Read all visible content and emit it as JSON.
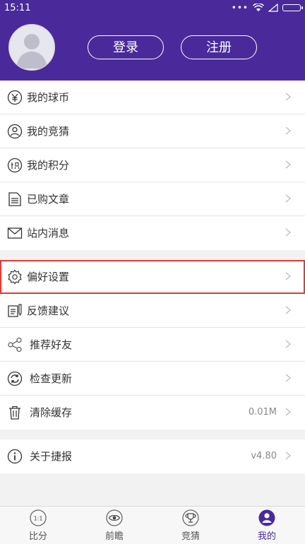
{
  "status_bar": {
    "time": "15:11"
  },
  "header": {
    "login_label": "登录",
    "register_label": "注册"
  },
  "menu_group_1": [
    {
      "label": "我的球币",
      "icon": "yen-coin-icon"
    },
    {
      "label": "我的竞猜",
      "icon": "user-circle-icon"
    },
    {
      "label": "我的积分",
      "icon": "points-icon"
    },
    {
      "label": "已购文章",
      "icon": "document-icon"
    },
    {
      "label": "站内消息",
      "icon": "mail-icon"
    }
  ],
  "menu_group_2": [
    {
      "label": "偏好设置",
      "icon": "gear-icon"
    },
    {
      "label": "反馈建议",
      "icon": "feedback-icon"
    },
    {
      "label": "推荐好友",
      "icon": "share-icon"
    },
    {
      "label": "检查更新",
      "icon": "refresh-icon"
    },
    {
      "label": "清除缓存",
      "icon": "trash-icon",
      "value": "0.01M"
    }
  ],
  "menu_group_3": [
    {
      "label": "关于捷报",
      "icon": "info-icon",
      "value": "v4.80"
    }
  ],
  "tabbar": [
    {
      "label": "比分",
      "icon": "score-icon",
      "icon_text": "1:1"
    },
    {
      "label": "前瞻",
      "icon": "eye-icon"
    },
    {
      "label": "竞猜",
      "icon": "trophy-icon"
    },
    {
      "label": "我的",
      "icon": "profile-icon",
      "active": true
    }
  ],
  "colors": {
    "brand": "#4a2a9a",
    "highlight": "#e53935"
  }
}
